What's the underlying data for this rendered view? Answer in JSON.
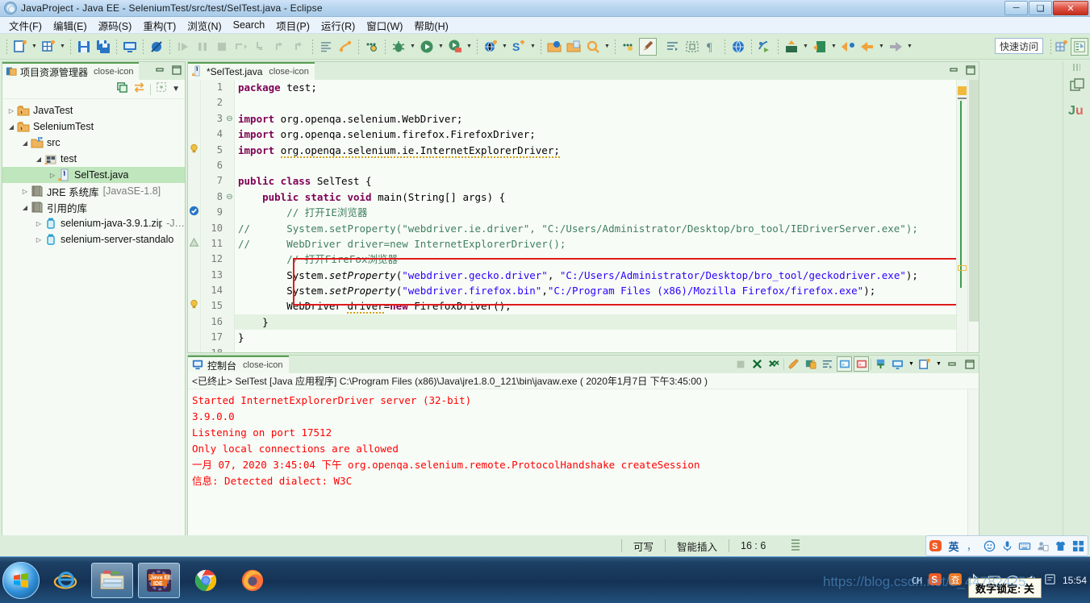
{
  "window": {
    "title": "JavaProject  -  Java EE  -  SeleniumTest/src/test/SelTest.java  -  Eclipse",
    "app_icon": "eclipse-icon",
    "minimize": "─",
    "maximize": "❑",
    "close": "✕"
  },
  "menubar": {
    "items": [
      {
        "label": "文件(F)",
        "name": "menu-file"
      },
      {
        "label": "编辑(E)",
        "name": "menu-edit"
      },
      {
        "label": "源码(S)",
        "name": "menu-source"
      },
      {
        "label": "重构(T)",
        "name": "menu-refactor"
      },
      {
        "label": "浏览(N)",
        "name": "menu-navigate"
      },
      {
        "label": "Search",
        "name": "menu-search"
      },
      {
        "label": "项目(P)",
        "name": "menu-project"
      },
      {
        "label": "运行(R)",
        "name": "menu-run"
      },
      {
        "label": "窗口(W)",
        "name": "menu-window"
      },
      {
        "label": "帮助(H)",
        "name": "menu-help"
      }
    ]
  },
  "toolbar": {
    "quick_access": "快速访问",
    "icons": [
      "new-wizard-icon",
      "new-menu-arrow",
      "new-grid-icon",
      "new-grid-arrow",
      "save-icon",
      "save-all-icon",
      "new-console-icon",
      "skip-breakpoints-icon",
      "resume-icon",
      "suspend-icon",
      "terminate-icon",
      "step-over-icon",
      "step-into-icon",
      "step-return-icon",
      "step-restart-icon",
      "open-task-icon",
      "link-task-icon",
      "debug-history-icon",
      "debug-icon",
      "debug-arrow",
      "run-icon",
      "run-arrow",
      "external-tools-icon",
      "external-tools-arrow",
      "new-web-icon",
      "new-web-arrow",
      "search-server-icon",
      "search-server-arrow",
      "open-type-icon",
      "open-task-browse-icon",
      "search-icon",
      "search-arrow",
      "more-icon",
      "annotation-edit-icon",
      "toggle-markoccur-icon",
      "block-select-icon",
      "whitespace-icon",
      "browser-icon",
      "open-perspective-mini-icon",
      "export-icon",
      "export-arrow",
      "import-icon",
      "import-arrow",
      "back-icon",
      "back-arrow",
      "forward-icon",
      "forward-arrow"
    ]
  },
  "explorer": {
    "tab_label": "项目资源管理器",
    "tab_icon": "package-explorer-icon",
    "close_icon": "close-icon",
    "toolbar_icons": [
      "collapse-all-icon",
      "link-with-editor-icon",
      "focus-icon",
      "view-menu-icon"
    ],
    "tree": [
      {
        "indent": 0,
        "twisty": "▷",
        "icon": "java-project-icon",
        "label": "JavaTest",
        "suffix": "",
        "selected": false
      },
      {
        "indent": 0,
        "twisty": "◢",
        "icon": "java-project-icon",
        "label": "SeleniumTest",
        "suffix": "",
        "selected": false
      },
      {
        "indent": 1,
        "twisty": "◢",
        "icon": "source-folder-icon",
        "label": "src",
        "suffix": "",
        "selected": false
      },
      {
        "indent": 2,
        "twisty": "◢",
        "icon": "package-icon",
        "label": "test",
        "suffix": "",
        "selected": false
      },
      {
        "indent": 3,
        "twisty": "▷",
        "icon": "java-file-icon",
        "label": "SelTest.java",
        "suffix": "",
        "selected": true
      },
      {
        "indent": 1,
        "twisty": "▷",
        "icon": "library-icon",
        "label": "JRE 系统库",
        "suffix": "[JavaSE-1.8]",
        "selected": false
      },
      {
        "indent": 1,
        "twisty": "◢",
        "icon": "library-icon",
        "label": "引用的库",
        "suffix": "",
        "selected": false
      },
      {
        "indent": 2,
        "twisty": "▷",
        "icon": "jar-icon",
        "label": "selenium-java-3.9.1.zip",
        "suffix": "-J…",
        "selected": false
      },
      {
        "indent": 2,
        "twisty": "▷",
        "icon": "jar-icon",
        "label": "selenium-server-standalo",
        "suffix": "",
        "selected": false
      }
    ]
  },
  "editor": {
    "tab_label": "*SelTest.java",
    "tab_icon": "java-file-warning-icon",
    "close_icon": "close-icon",
    "minimize_icon": "minimize-icon",
    "maximize_icon": "maximize-icon",
    "lines": [
      {
        "no": "1",
        "fold": "",
        "marker": "",
        "html": "<span class=\"kw\">package</span> test;"
      },
      {
        "no": "2",
        "fold": "",
        "marker": "",
        "html": ""
      },
      {
        "no": "3",
        "fold": "⊖",
        "marker": "",
        "html": "<span class=\"kw\">import</span> org.openqa.selenium.WebDriver;"
      },
      {
        "no": "4",
        "fold": "",
        "marker": "",
        "html": "<span class=\"kw\">import</span> org.openqa.selenium.firefox.FirefoxDriver;"
      },
      {
        "no": "5",
        "fold": "",
        "marker": "bulb",
        "html": "<span class=\"kw\">import</span> <span class=\"warnsquig\">org.openqa.selenium.ie.InternetExplorerDriver;</span>"
      },
      {
        "no": "6",
        "fold": "",
        "marker": "",
        "html": ""
      },
      {
        "no": "7",
        "fold": "",
        "marker": "",
        "html": "<span class=\"kw\">public class</span> SelTest {"
      },
      {
        "no": "8",
        "fold": "⊖",
        "marker": "",
        "html": "    <span class=\"kw\">public static void</span> main(String[] args) {"
      },
      {
        "no": "9",
        "fold": "",
        "marker": "check",
        "html": "        <span class=\"cmt\">// 打开IE浏览器</span>"
      },
      {
        "no": "10",
        "fold": "",
        "marker": "",
        "html": "<span class=\"cmt\">//      System.setProperty(\"webdriver.ie.driver\", \"C:/Users/Administrator/Desktop/bro_tool/IEDriverServer.exe\");</span>"
      },
      {
        "no": "11",
        "fold": "",
        "marker": "warn",
        "html": "<span class=\"cmt\">//      WebDriver driver=new InternetExplorerDriver();</span>"
      },
      {
        "no": "12",
        "fold": "",
        "marker": "",
        "html": "        <span class=\"cmt\">// 打开FireFox浏览器</span>"
      },
      {
        "no": "13",
        "fold": "",
        "marker": "",
        "html": "        System.<span class=\"ital\">setProperty</span>(<span class=\"str\">\"webdriver.gecko.driver\"</span>, <span class=\"str\">\"C:/Users/Administrator/Desktop/bro_tool/geckodriver.exe\"</span>);"
      },
      {
        "no": "14",
        "fold": "",
        "marker": "",
        "html": "        System.<span class=\"ital\">setProperty</span>(<span class=\"str\">\"webdriver.firefox.bin\"</span>,<span class=\"str\">\"C:/Program Files (x86)/Mozilla Firefox/firefox.exe\"</span>);"
      },
      {
        "no": "15",
        "fold": "",
        "marker": "bulb",
        "html": "        WebDriver <span class=\"warnsquig\">driver</span>=<span class=\"kw\">new</span> FirefoxDriver();"
      },
      {
        "no": "16",
        "fold": "",
        "marker": "",
        "html": "    }"
      },
      {
        "no": "17",
        "fold": "",
        "marker": "",
        "html": "}"
      },
      {
        "no": "18",
        "fold": "",
        "marker": "",
        "html": ""
      }
    ]
  },
  "console": {
    "tab_label": "控制台",
    "tab_icon": "console-icon",
    "close_icon": "close-icon",
    "header": "<已终止> SelTest [Java 应用程序] C:\\Program Files (x86)\\Java\\jre1.8.0_121\\bin\\javaw.exe ( 2020年1月7日 下午3:45:00 )",
    "toolbar_icons": [
      "terminate-icon",
      "remove-launch-icon",
      "remove-all-launches-icon",
      "clear-console-icon",
      "lock-scroll-icon",
      "wrap-text-icon",
      "show-console-stdout-icon",
      "show-console-stderr-icon",
      "pin-console-icon",
      "display-selected-console-icon",
      "display-selected-arrow",
      "open-console-icon",
      "open-console-arrow",
      "minimize-icon",
      "maximize-icon"
    ],
    "output_color": "#ff0000",
    "output": [
      "Started InternetExplorerDriver server (32-bit)",
      "3.9.0.0",
      "Listening on port 17512",
      "Only local connections are allowed",
      "一月 07, 2020 3:45:04 下午 org.openqa.selenium.remote.ProtocolHandshake createSession",
      "信息: Detected dialect: W3C"
    ]
  },
  "right_strip": {
    "icons": [
      "restore-view-icon",
      "junit-view-icon"
    ]
  },
  "statusbar": {
    "writable": "可写",
    "insert_mode": "智能插入",
    "position": "16 : 6"
  },
  "ime_tray": {
    "icons": [
      "sogou-logo-icon",
      "chinese-english-icon",
      "punctuation-icon",
      "emoji-icon",
      "voice-input-icon",
      "soft-keyboard-icon",
      "user-icon",
      "skin-icon",
      "toolbox-icon"
    ],
    "mode_label": "英"
  },
  "taskbar": {
    "start_label": "start-orb-icon",
    "items": [
      {
        "name": "taskbar-item-ie",
        "icon": "internet-explorer-icon",
        "active": false
      },
      {
        "name": "taskbar-item-explorer",
        "icon": "file-explorer-icon",
        "active": true
      },
      {
        "name": "taskbar-item-eclipse",
        "icon": "java-ee-ide-icon",
        "active": true
      },
      {
        "name": "taskbar-item-chrome",
        "icon": "chrome-icon",
        "active": false
      },
      {
        "name": "taskbar-item-firefox",
        "icon": "firefox-icon",
        "active": false
      }
    ],
    "tray": {
      "lang": "CH",
      "icons": [
        "sogou-tray-icon",
        "sogou-alt-icon",
        "bluetooth-icon",
        "keyboard-tray-icon",
        "network-icon",
        "volume-icon",
        "action-center-icon"
      ],
      "clock_time": "15:54",
      "numlock_tip": "数字锁定: 关"
    }
  },
  "watermark": "https://blog.csdn.net/u_44782425"
}
